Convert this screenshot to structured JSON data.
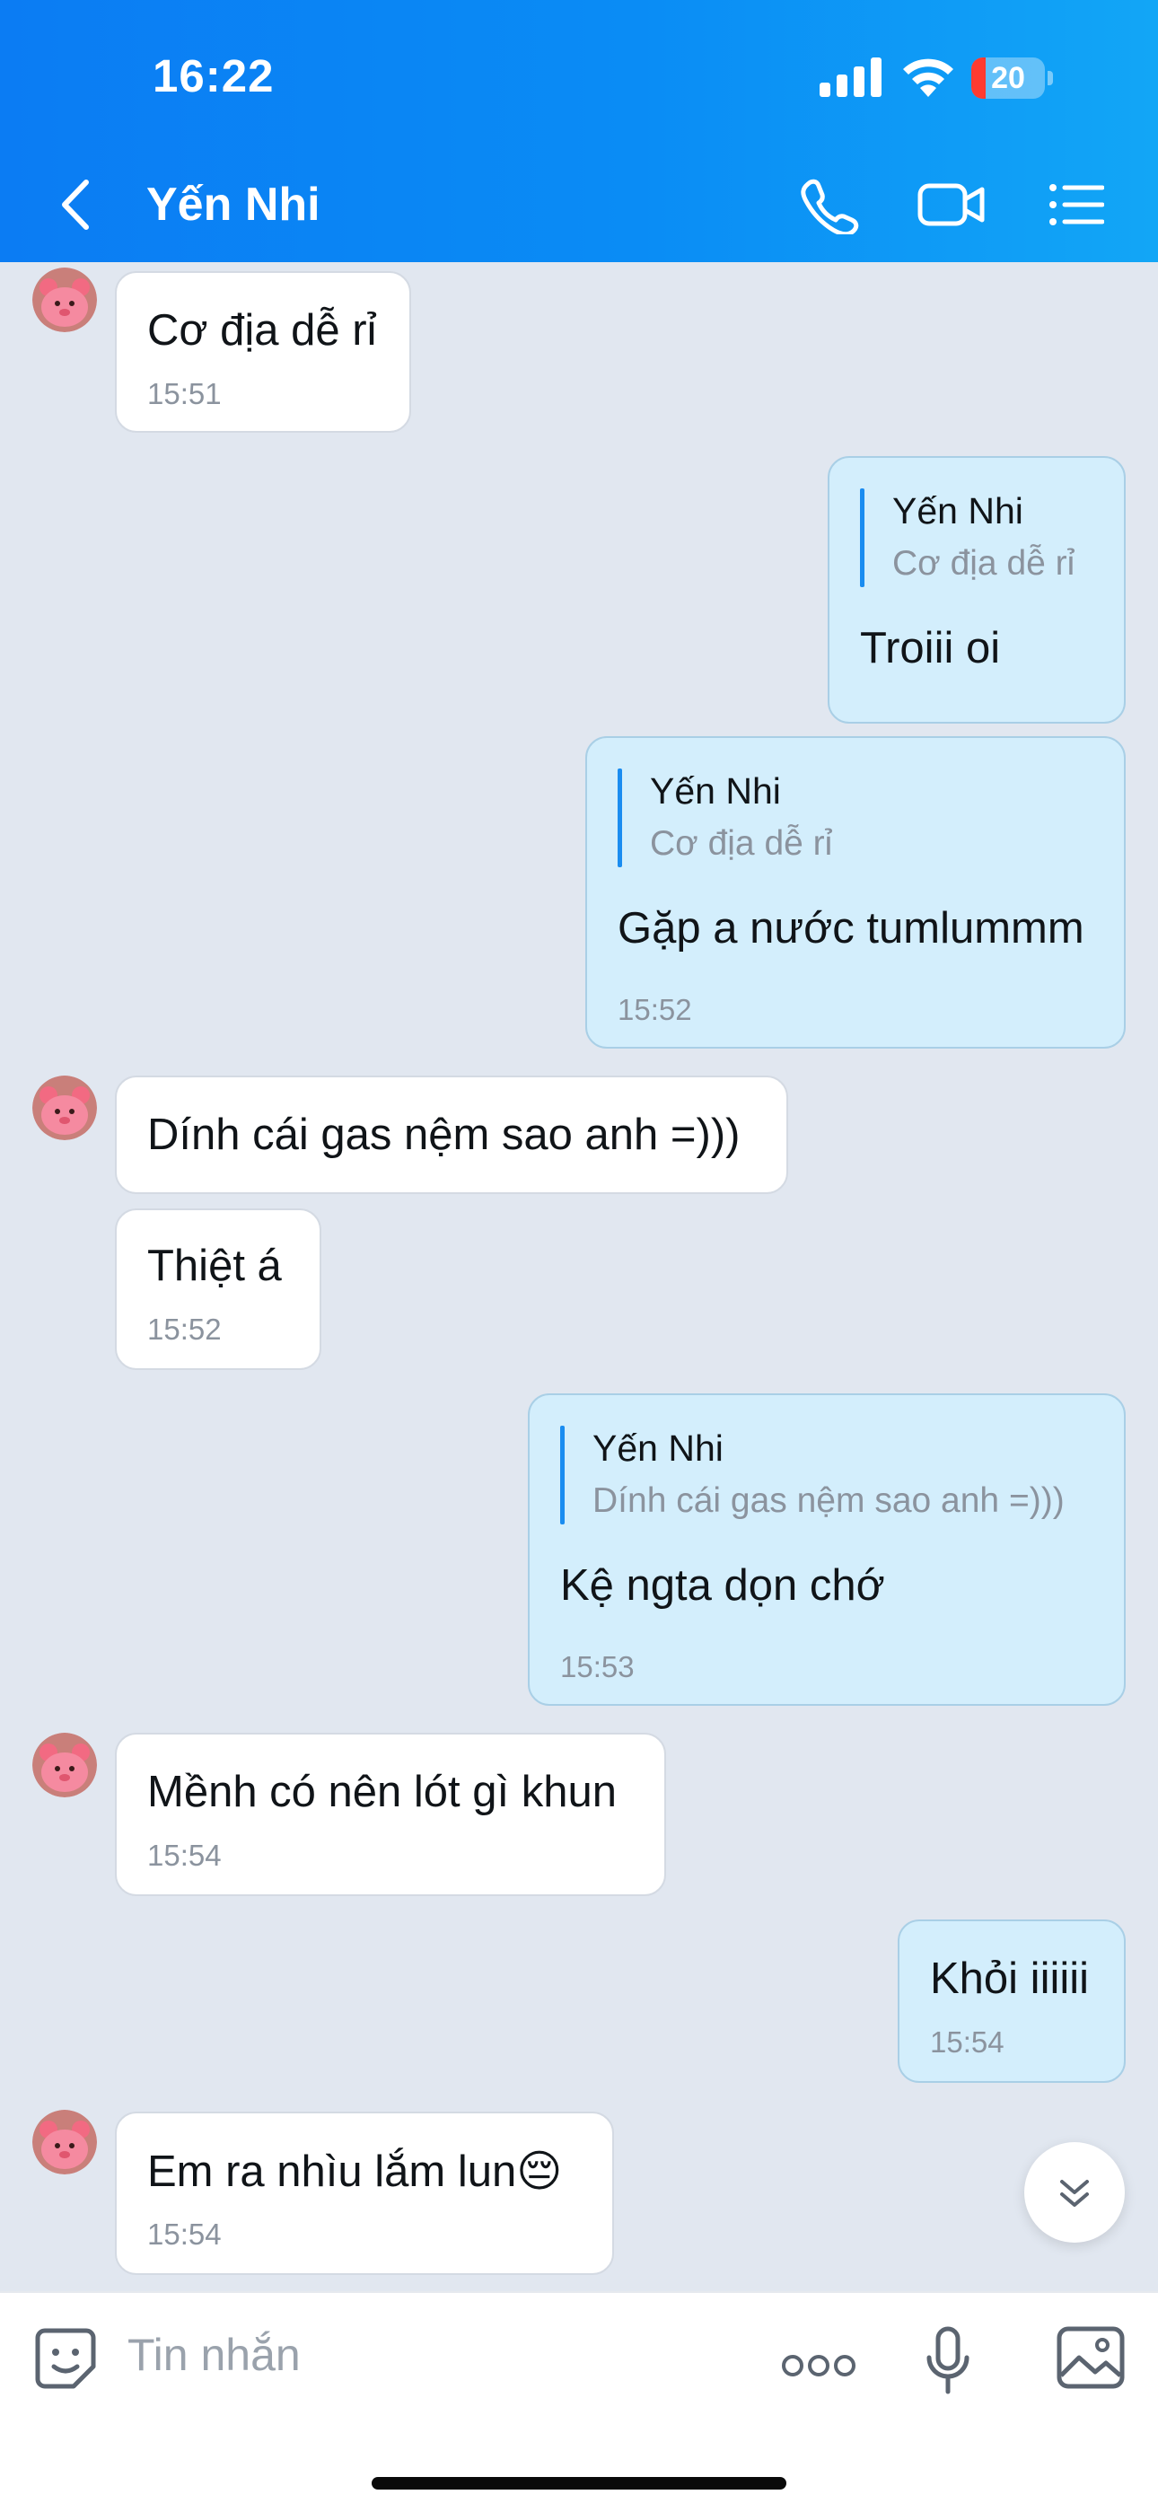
{
  "status_bar": {
    "time": "16:22",
    "battery": "20",
    "battery_level": 0.2
  },
  "header": {
    "title": "Yến Nhi"
  },
  "messages": [
    {
      "text": "Cơ địa dễ rỉ",
      "time": "15:51"
    },
    {
      "quote_name": "Yến Nhi",
      "quote_text": "Cơ địa dễ rỉ",
      "text": "Troiii oi"
    },
    {
      "quote_name": "Yến Nhi",
      "quote_text": "Cơ địa dễ rỉ",
      "text": "Gặp a nước tumlummm",
      "time": "15:52"
    },
    {
      "text": "Dính cái gas nệm sao anh =)))"
    },
    {
      "text": "Thiệt á",
      "time": "15:52"
    },
    {
      "quote_name": "Yến Nhi",
      "quote_text": "Dính cái gas nệm sao anh =)))",
      "text": "Kệ ngta dọn chớ",
      "time": "15:53"
    },
    {
      "text": "Mềnh có nên lót gì khun",
      "time": "15:54"
    },
    {
      "text": "Khỏi iiiiii",
      "time": "15:54"
    },
    {
      "text": "Em ra nhìu lắm lun😔",
      "time": "15:54"
    }
  ],
  "composer": {
    "placeholder": "Tin nhắn"
  }
}
